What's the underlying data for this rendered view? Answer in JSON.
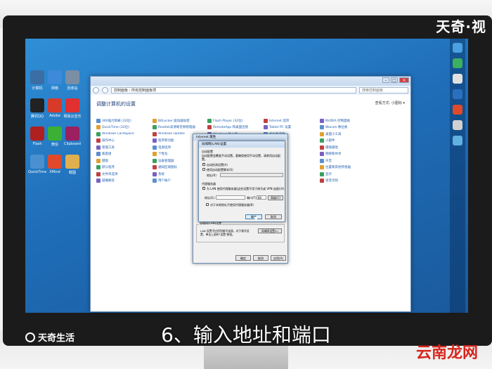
{
  "caption": "6、输入地址和端口",
  "watermark_top": "天奇·视",
  "watermark_bottom": "天奇生活",
  "brand_bottom_right": "云南龙网",
  "colors": {
    "accent": "#1f5fb0",
    "desktop": "#1f6db8",
    "brand_red": "#d7261e"
  },
  "desktop_icons": [
    {
      "label": "计算机",
      "icon": "computer-icon",
      "color": "#3a6ea5"
    },
    {
      "label": "网络",
      "icon": "network-icon",
      "color": "#3c8ad9"
    },
    {
      "label": "回收站",
      "icon": "recycle-bin-icon",
      "color": "#7a8fa6"
    },
    {
      "label": "腾讯QQ",
      "icon": "qq-icon",
      "color": "#222"
    },
    {
      "label": "Adobe",
      "icon": "adobe-icon",
      "color": "#d83a2a"
    },
    {
      "label": "网易云音乐",
      "icon": "music-icon",
      "color": "#e03030"
    },
    {
      "label": "Flash",
      "icon": "flash-icon",
      "color": "#b02020"
    },
    {
      "label": "微信",
      "icon": "wechat-icon",
      "color": "#3cb034"
    },
    {
      "label": "Clipboard",
      "icon": "clipboard-icon",
      "color": "#9a2060"
    },
    {
      "label": "QuickTime Player",
      "icon": "quicktime-icon",
      "color": "#4a90d0"
    },
    {
      "label": "XMind",
      "icon": "xmind-icon",
      "color": "#e04a2a"
    },
    {
      "label": "截图",
      "icon": "folder-icon",
      "color": "#e0b050"
    }
  ],
  "explorer": {
    "path": "控制面板 › 所有控制面板项",
    "search_placeholder": "搜索控制面板",
    "heading": "调整计算机的设置",
    "view_by": "查看方式: 小图标 ▾",
    "columns": [
      [
        "360强力卸载 (32位)",
        "QuickTime (32位)",
        "Windows CardSpace",
        "操作中心",
        "管理工具",
        "家庭组",
        "键盘",
        "默认程序",
        "文件夹选项",
        "疑难解答"
      ],
      [
        "BitLocker 驱动器加密",
        "Realtek高清晰音频管理器",
        "Windows Update",
        "程序和功能",
        "电源选项",
        "个性化",
        "设备管理器",
        "通知区域图标",
        "系统",
        "用户帐户"
      ],
      [
        "Flash Player (32位)",
        "RemoteApp 和桌面连接",
        "Windows 防火墙",
        "Internet 选项",
        "Windows 移动中心",
        "电话和调制解调器",
        "恢复",
        "凭据管理器",
        "区域和语言",
        "颜色管理"
      ],
      [
        "Internet 选项",
        "Tablet PC 设置",
        "备份和还原",
        "操作中心",
        "凭据管理器",
        "任务栏",
        "设备和打印机",
        "索引选项",
        "字体",
        "自动播放"
      ],
      [
        "NVIDIA 控制面板",
        "Wacom 数位板",
        "桌面小工具",
        "小部件",
        "键盘属性",
        "网络和共享",
        "声音",
        "位置和其他传感器",
        "显示",
        "语音识别"
      ]
    ]
  },
  "internet_options": {
    "title": "Internet 属性",
    "lan_group": "局域网(LAN)设置",
    "lan_text": "LAN 设置不应用到拨号连接。对于拨号设置，单击上面的\"设置\"按钮。",
    "lan_button": "局域网设置(L)",
    "ok": "确定",
    "cancel": "取消",
    "apply": "应用(A)"
  },
  "lan_settings": {
    "title": "局域网(LAN)设置",
    "auto_group": "自动配置",
    "auto_desc": "自动配置会覆盖手动设置。要确保使用手动设置，请禁用自动配置。",
    "auto_detect": "自动检测设置(A)",
    "auto_detect_checked": true,
    "use_script": "使用自动配置脚本(S)",
    "use_script_checked": false,
    "address_label": "地址(R)",
    "proxy_group": "代理服务器",
    "use_proxy": "为 LAN 使用代理服务器(这些设置不用于拨号或 VPN 连接)(X)",
    "use_proxy_checked": true,
    "addr_field_label": "地址(E):",
    "port_label": "端口(T):",
    "port_value": "80",
    "advanced": "高级(C)",
    "bypass": "对于本地地址不使用代理服务器(B)",
    "bypass_checked": false,
    "ok": "确定",
    "cancel": "取消"
  }
}
